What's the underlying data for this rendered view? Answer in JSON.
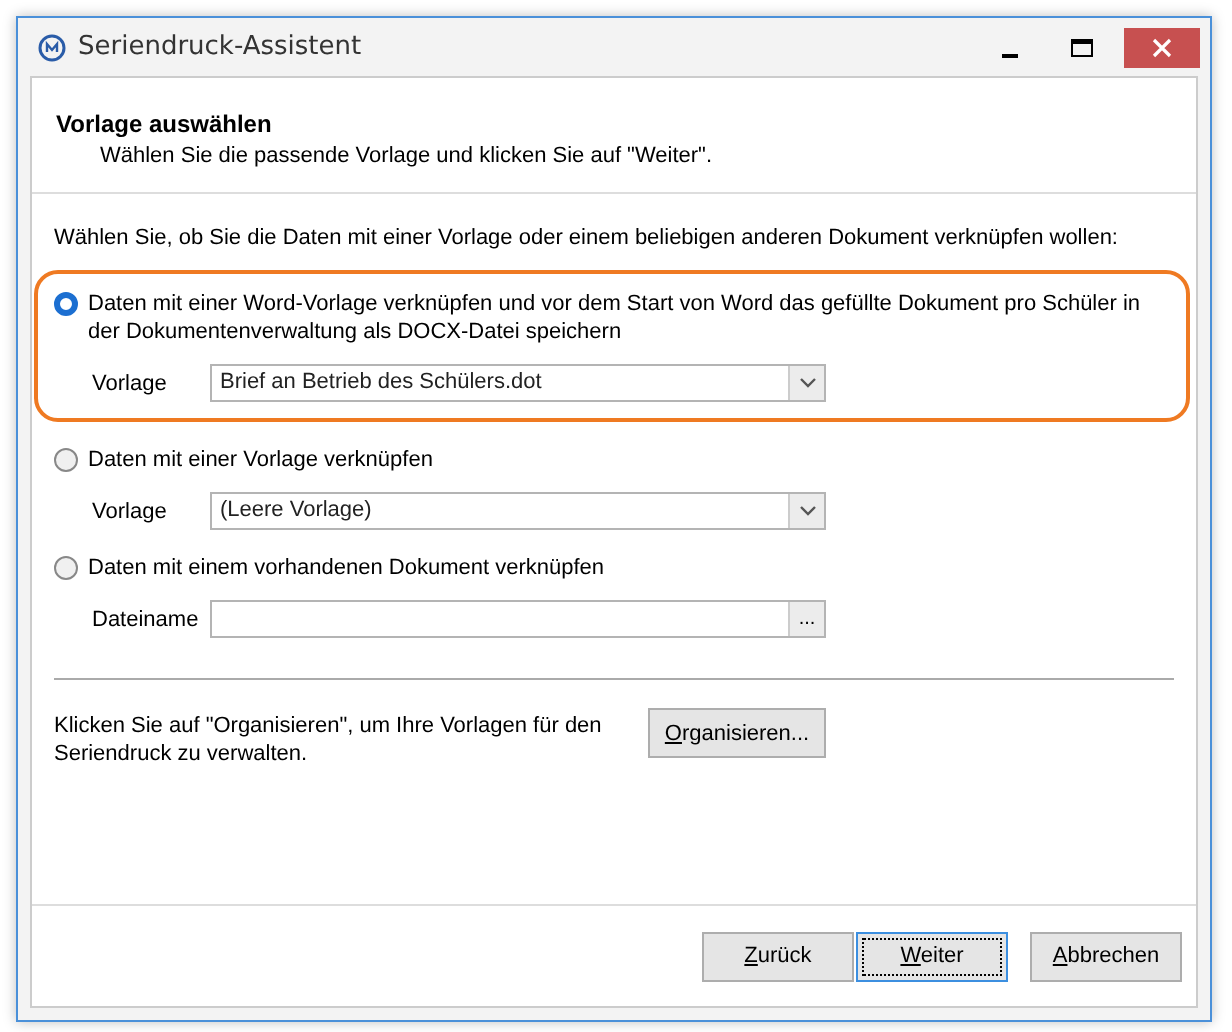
{
  "window": {
    "title": "Seriendruck-Assistent"
  },
  "header": {
    "title": "Vorlage auswählen",
    "subtitle": "Wählen Sie die passende Vorlage und klicken Sie auf \"Weiter\"."
  },
  "intro": "Wählen Sie, ob Sie die Daten mit einer Vorlage oder einem beliebigen anderen Dokument verknüpfen wollen:",
  "options": [
    {
      "label": "Daten mit einer Word-Vorlage verknüpfen und vor dem Start von Word das gefüllte Dokument pro Schüler in der Dokumentenverwaltung als DOCX-Datei speichern",
      "selected": true,
      "highlighted": true,
      "field": {
        "kind": "dropdown",
        "label": "Vorlage",
        "value": "Brief an Betrieb des Schülers.dot"
      }
    },
    {
      "label": "Daten mit einer Vorlage verknüpfen",
      "selected": false,
      "highlighted": false,
      "field": {
        "kind": "dropdown",
        "label": "Vorlage",
        "value": "(Leere Vorlage)"
      }
    },
    {
      "label": "Daten mit einem vorhandenen Dokument verknüpfen",
      "selected": false,
      "highlighted": false,
      "field": {
        "kind": "file",
        "label": "Dateiname",
        "button": "..."
      }
    }
  ],
  "organize": {
    "text": "Klicken Sie auf \"Organisieren\", um Ihre Vorlagen für den Seriendruck zu verwalten.",
    "button": "Organisieren..."
  },
  "buttons": [
    {
      "label": "Zurück",
      "default": false
    },
    {
      "label": "Weiter",
      "default": true
    },
    {
      "label": "Abbrechen",
      "default": false
    }
  ]
}
